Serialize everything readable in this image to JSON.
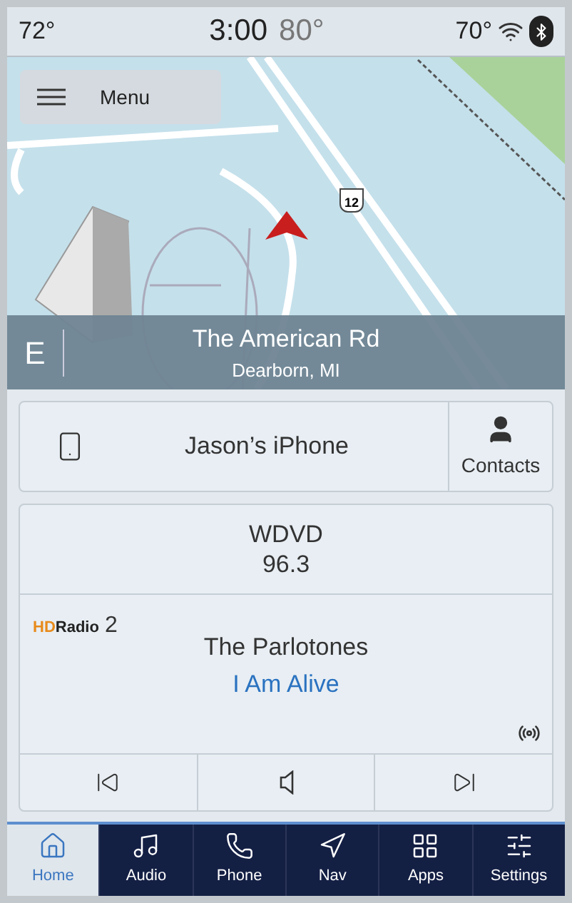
{
  "status_bar": {
    "outside_temp": "72°",
    "time": "3:00",
    "interior_temp": "80°",
    "passenger_temp": "70°"
  },
  "map": {
    "menu_button": "Menu",
    "route_shield": "12",
    "heading": "E",
    "street": "The American Rd",
    "city": "Dearborn, MI"
  },
  "phone_card": {
    "device": "Jason’s iPhone",
    "contacts_button": "Contacts"
  },
  "radio_card": {
    "station": "WDVD",
    "frequency": "96.3",
    "logo_mark": "HD",
    "logo_word": "Radio",
    "hd_channel": "2",
    "artist": "The Parlotones",
    "song": "I Am Alive",
    "controls": [
      {
        "kind": "previous"
      },
      {
        "kind": "mute"
      },
      {
        "kind": "next"
      }
    ]
  },
  "nav_bar": [
    {
      "kind": "home",
      "label": "Home",
      "selected": true
    },
    {
      "kind": "audio",
      "label": "Audio",
      "selected": false
    },
    {
      "kind": "phone",
      "label": "Phone",
      "selected": false
    },
    {
      "kind": "nav",
      "label": "Nav",
      "selected": false
    },
    {
      "kind": "apps",
      "label": "Apps",
      "selected": false
    },
    {
      "kind": "settings",
      "label": "Settings",
      "selected": false
    }
  ]
}
